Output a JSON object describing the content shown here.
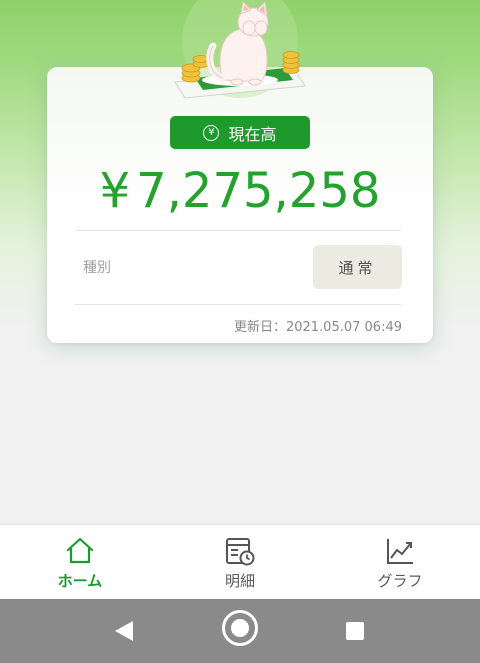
{
  "balance": {
    "badge_label": "現在高",
    "badge_icon": "yen-circle-icon",
    "currency_symbol": "¥",
    "amount": "7,275,258"
  },
  "account": {
    "type_label": "種別",
    "type_value": "通常",
    "updated": "更新日：2021.05.07 06:49"
  },
  "bottom_nav": {
    "items": [
      {
        "label": "ホーム",
        "icon": "home-icon",
        "active": true
      },
      {
        "label": "明細",
        "icon": "statement-icon",
        "active": false
      },
      {
        "label": "グラフ",
        "icon": "chart-icon",
        "active": false
      }
    ]
  },
  "system_nav": {
    "buttons": [
      "back-icon",
      "home-circle-icon",
      "recents-icon"
    ]
  },
  "colors": {
    "accent": "#1e9a2d",
    "amount": "#23a22e",
    "header_green": "#8ed06a"
  }
}
